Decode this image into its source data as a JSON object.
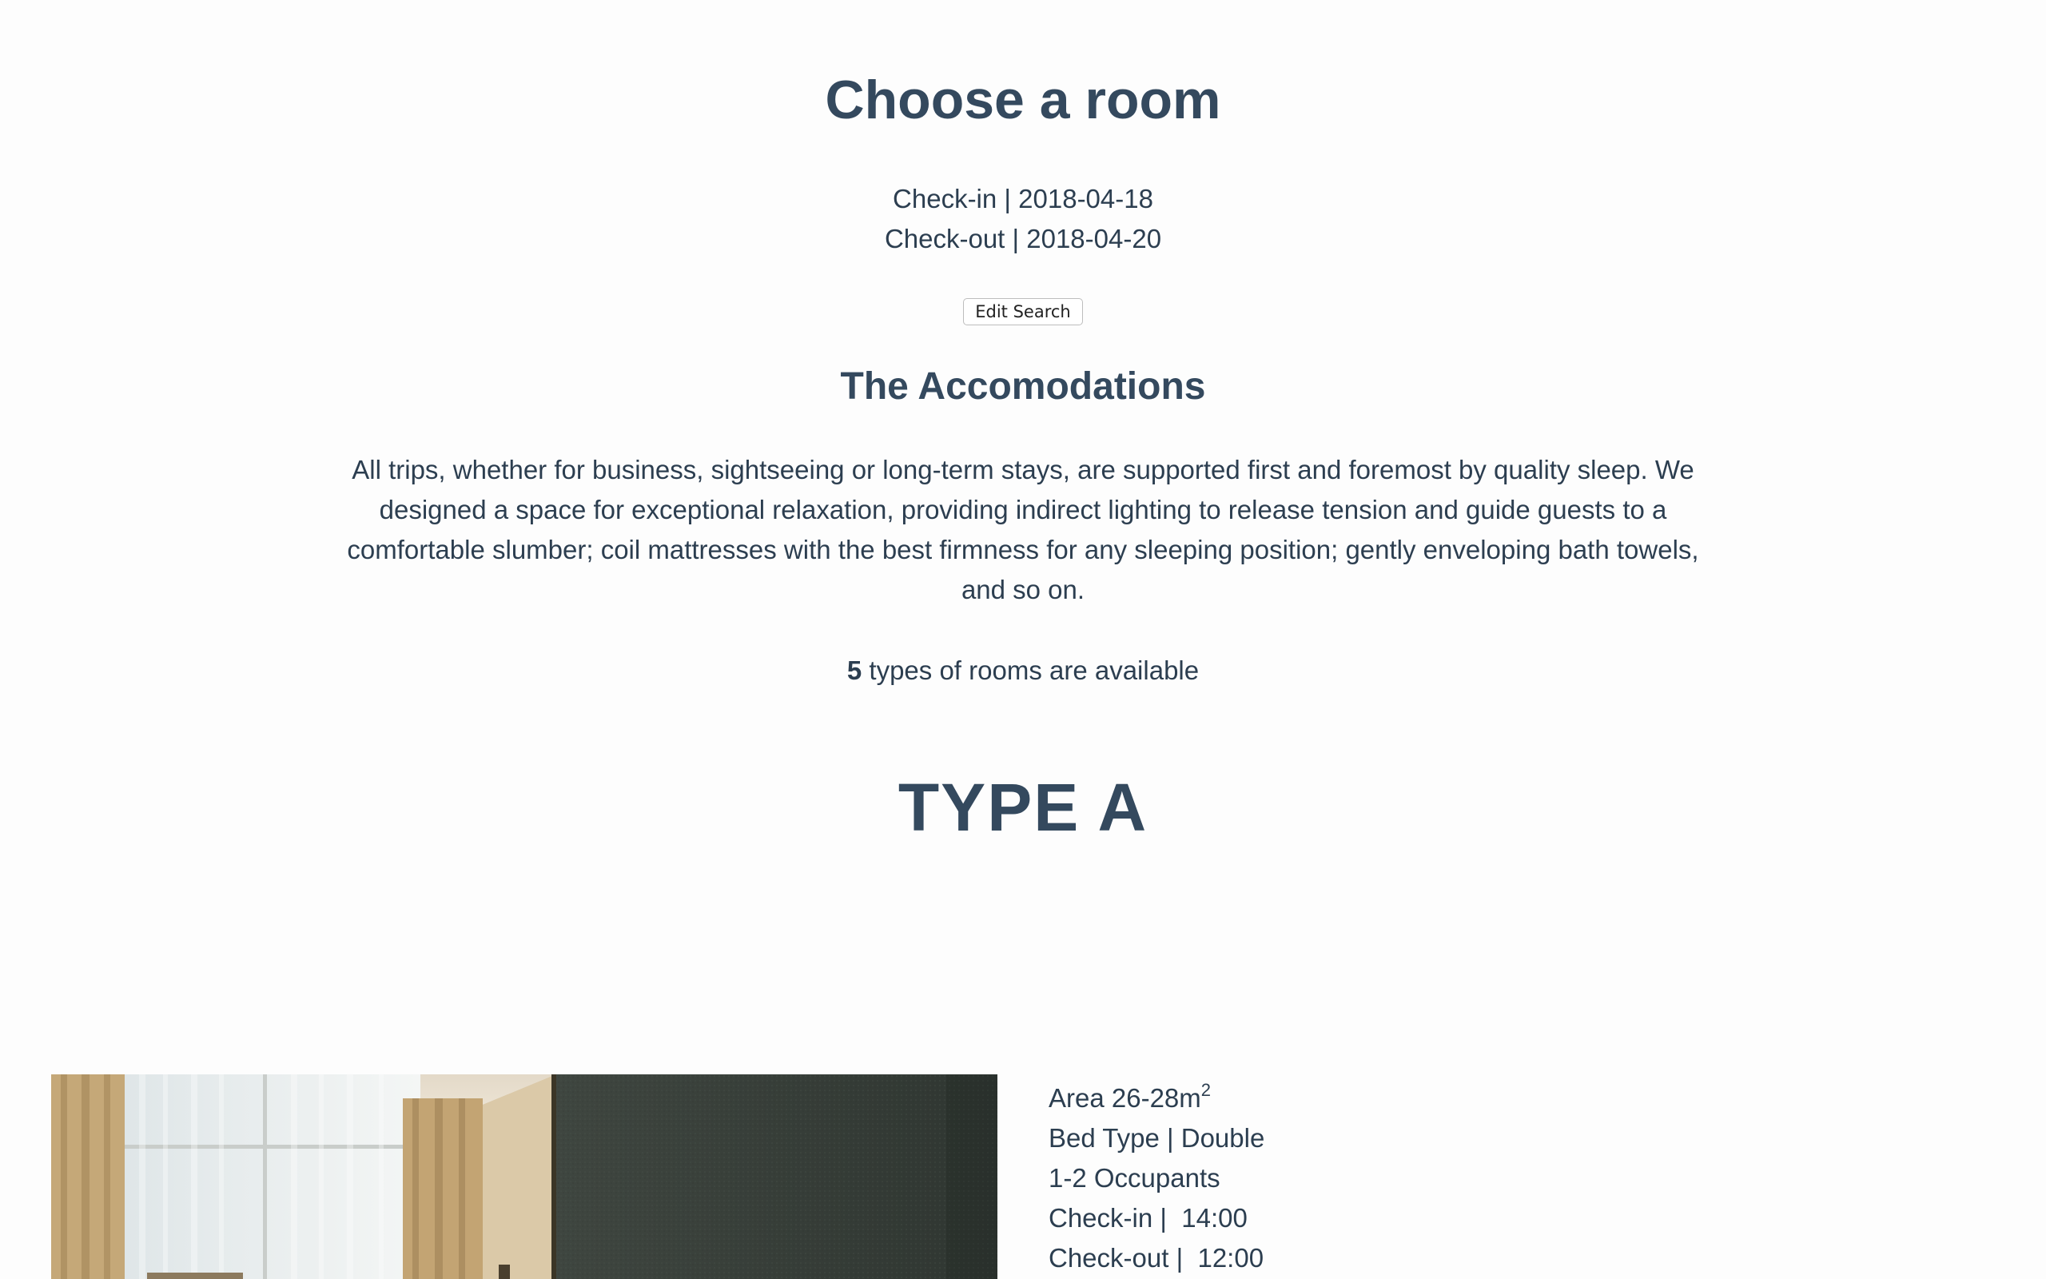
{
  "header": {
    "title": "Choose a room",
    "checkin": "Check-in | 2018-04-18",
    "checkout": "Check-out | 2018-04-20",
    "edit_label": "Edit Search"
  },
  "accommodations": {
    "title": "The Accomodations",
    "description": "All trips, whether for business, sightseeing or long-term stays, are supported first and foremost by quality sleep. We designed a space for exceptional relaxation, providing indirect lighting to release tension and guide guests to a comfortable slumber; coil mattresses with the best firmness for any sleeping position; gently enveloping bath towels, and so on."
  },
  "availability": {
    "count": "5",
    "text": " types of rooms are available"
  },
  "room": {
    "type": "TYPE A",
    "area": "Area 26-28m",
    "area_unit_sup": "2",
    "bed_type": "Bed Type | Double",
    "occupants": "1-2 Occupants",
    "checkin_time": "Check-in |  14:00",
    "checkout_time": "Check-out |  12:00"
  }
}
